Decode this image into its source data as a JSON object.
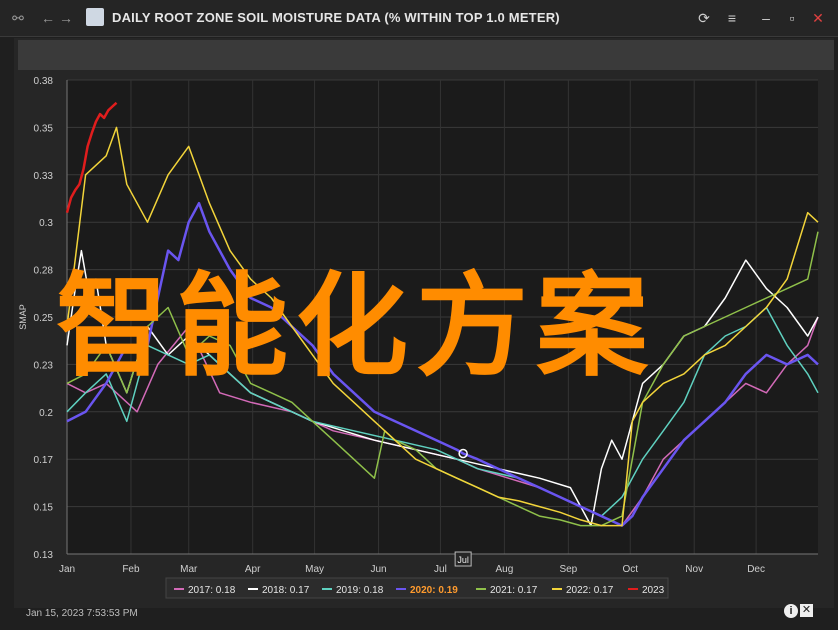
{
  "window": {
    "title": "DAILY ROOT ZONE SOIL MOISTURE DATA (% WITHIN TOP 1.0 METER)",
    "icons": [
      "link-icon",
      "back-icon",
      "forward-icon",
      "refresh-icon",
      "menu-icon",
      "minimize-icon",
      "maximize-icon",
      "close-icon"
    ]
  },
  "footer": {
    "timestamp": "Jan 15, 2023 7:53:53 PM"
  },
  "overlay_text": "智能化方案",
  "chart_data": {
    "type": "line",
    "ylabel": "SMAP",
    "ylim": [
      0.13,
      0.38
    ],
    "yticks": [
      "0.38",
      "0.35",
      "0.33",
      "0.3",
      "0.28",
      "0.25",
      "0.23",
      "0.2",
      "0.17",
      "0.15",
      "0.13"
    ],
    "ytick_values": [
      0.38,
      0.355,
      0.33,
      0.305,
      0.28,
      0.255,
      0.23,
      0.205,
      0.18,
      0.155,
      0.13
    ],
    "xlim": [
      1,
      365
    ],
    "xticks": [
      "Jan",
      "Feb",
      "Mar",
      "Apr",
      "May",
      "Jun",
      "Jul",
      "Aug",
      "Sep",
      "Oct",
      "Nov",
      "Dec"
    ],
    "xtick_days": [
      1,
      32,
      60,
      91,
      121,
      152,
      182,
      213,
      244,
      274,
      305,
      335
    ],
    "cursor_label": "Jul",
    "cursor_day": 193,
    "grid": true,
    "legend_position": "bottom",
    "series": [
      {
        "name": "2017: 0.18",
        "color": "#d36ab8",
        "x": [
          1,
          10,
          20,
          30,
          35,
          45,
          60,
          75,
          90,
          110,
          130,
          150,
          170,
          190,
          200,
          215,
          230,
          250,
          260,
          270,
          280,
          290,
          300,
          310,
          320,
          330,
          340,
          350,
          360,
          365
        ],
        "y": [
          0.22,
          0.215,
          0.22,
          0.21,
          0.205,
          0.23,
          0.25,
          0.215,
          0.21,
          0.205,
          0.195,
          0.19,
          0.185,
          0.18,
          0.175,
          0.17,
          0.165,
          0.155,
          0.15,
          0.145,
          0.16,
          0.18,
          0.19,
          0.2,
          0.21,
          0.22,
          0.215,
          0.23,
          0.24,
          0.255
        ]
      },
      {
        "name": "2018: 0.17",
        "color": "#ffffff",
        "x": [
          1,
          5,
          8,
          12,
          15,
          20,
          30,
          40,
          50,
          60,
          70,
          80,
          90,
          100,
          110,
          120,
          135,
          150,
          170,
          190,
          210,
          230,
          245,
          250,
          255,
          260,
          265,
          270,
          275,
          280,
          290,
          300,
          310,
          320,
          330,
          340,
          350,
          360,
          365
        ],
        "y": [
          0.24,
          0.27,
          0.29,
          0.265,
          0.275,
          0.24,
          0.215,
          0.25,
          0.235,
          0.245,
          0.235,
          0.225,
          0.215,
          0.21,
          0.205,
          0.2,
          0.195,
          0.19,
          0.185,
          0.18,
          0.175,
          0.17,
          0.165,
          0.155,
          0.145,
          0.175,
          0.19,
          0.18,
          0.2,
          0.22,
          0.23,
          0.245,
          0.25,
          0.265,
          0.285,
          0.27,
          0.26,
          0.245,
          0.255
        ]
      },
      {
        "name": "2019: 0.18",
        "color": "#5fd1c0",
        "x": [
          1,
          10,
          20,
          30,
          40,
          50,
          60,
          70,
          80,
          90,
          100,
          110,
          120,
          140,
          160,
          180,
          200,
          220,
          240,
          260,
          270,
          280,
          290,
          300,
          310,
          320,
          330,
          340,
          350,
          360,
          365
        ],
        "y": [
          0.205,
          0.215,
          0.225,
          0.2,
          0.24,
          0.235,
          0.23,
          0.235,
          0.225,
          0.215,
          0.21,
          0.205,
          0.2,
          0.195,
          0.19,
          0.185,
          0.175,
          0.17,
          0.16,
          0.15,
          0.16,
          0.18,
          0.195,
          0.21,
          0.235,
          0.245,
          0.25,
          0.26,
          0.24,
          0.225,
          0.215
        ]
      },
      {
        "name": "2020: 0.19",
        "color": "#6a55f0",
        "x": [
          1,
          10,
          20,
          30,
          40,
          45,
          50,
          55,
          60,
          65,
          70,
          80,
          90,
          100,
          110,
          120,
          130,
          140,
          150,
          160,
          170,
          180,
          190,
          193,
          200,
          210,
          220,
          230,
          240,
          250,
          260,
          270,
          275,
          280,
          290,
          300,
          310,
          320,
          330,
          340,
          350,
          360,
          365
        ],
        "y": [
          0.2,
          0.205,
          0.22,
          0.24,
          0.24,
          0.265,
          0.29,
          0.285,
          0.305,
          0.315,
          0.3,
          0.28,
          0.265,
          0.26,
          0.25,
          0.24,
          0.225,
          0.215,
          0.205,
          0.2,
          0.195,
          0.19,
          0.185,
          0.183,
          0.18,
          0.175,
          0.17,
          0.165,
          0.16,
          0.155,
          0.15,
          0.145,
          0.15,
          0.16,
          0.175,
          0.19,
          0.2,
          0.21,
          0.225,
          0.235,
          0.23,
          0.235,
          0.23
        ]
      },
      {
        "name": "2021: 0.17",
        "color": "#8fc04a",
        "x": [
          1,
          10,
          20,
          30,
          40,
          50,
          60,
          70,
          80,
          90,
          100,
          110,
          120,
          130,
          140,
          150,
          155,
          160,
          170,
          180,
          190,
          200,
          210,
          220,
          230,
          240,
          250,
          260,
          270,
          280,
          290,
          300,
          310,
          320,
          330,
          340,
          350,
          360,
          365
        ],
        "y": [
          0.22,
          0.225,
          0.24,
          0.215,
          0.25,
          0.26,
          0.235,
          0.245,
          0.24,
          0.22,
          0.215,
          0.21,
          0.2,
          0.19,
          0.18,
          0.17,
          0.195,
          0.19,
          0.185,
          0.175,
          0.17,
          0.165,
          0.16,
          0.155,
          0.15,
          0.148,
          0.145,
          0.145,
          0.15,
          0.21,
          0.23,
          0.245,
          0.25,
          0.255,
          0.26,
          0.265,
          0.27,
          0.275,
          0.3
        ]
      },
      {
        "name": "2022: 0.17",
        "color": "#f2d43a",
        "x": [
          1,
          10,
          20,
          25,
          30,
          40,
          50,
          60,
          70,
          80,
          90,
          100,
          110,
          120,
          130,
          140,
          150,
          160,
          170,
          180,
          190,
          200,
          210,
          220,
          230,
          240,
          250,
          260,
          270,
          275,
          280,
          290,
          300,
          310,
          320,
          330,
          340,
          350,
          360,
          365
        ],
        "y": [
          0.25,
          0.33,
          0.34,
          0.355,
          0.325,
          0.305,
          0.33,
          0.345,
          0.315,
          0.29,
          0.275,
          0.265,
          0.25,
          0.235,
          0.22,
          0.21,
          0.2,
          0.19,
          0.18,
          0.175,
          0.17,
          0.165,
          0.16,
          0.158,
          0.155,
          0.152,
          0.148,
          0.145,
          0.145,
          0.2,
          0.21,
          0.22,
          0.225,
          0.235,
          0.24,
          0.25,
          0.26,
          0.275,
          0.31,
          0.305
        ]
      },
      {
        "name": "2023",
        "color": "#e01d1d",
        "x": [
          1,
          3,
          5,
          7,
          9,
          11,
          13,
          15,
          17,
          19,
          21,
          23,
          25
        ],
        "y": [
          0.31,
          0.318,
          0.322,
          0.325,
          0.333,
          0.345,
          0.352,
          0.358,
          0.362,
          0.36,
          0.364,
          0.366,
          0.368
        ]
      }
    ]
  }
}
